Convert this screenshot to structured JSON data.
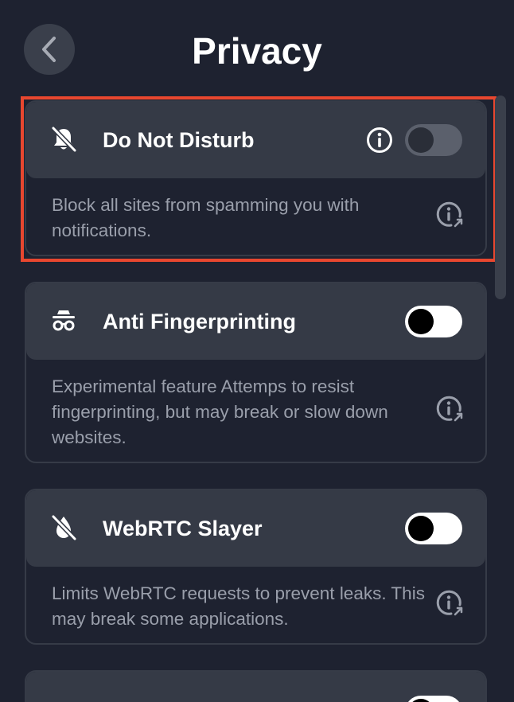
{
  "header": {
    "title": "Privacy",
    "back_icon": "chevron-left-icon"
  },
  "cards": [
    {
      "title": "Do Not Disturb",
      "icon": "bell-off-icon",
      "description": "Block all sites from spamming you with notifications.",
      "toggle_on": false,
      "has_info_icon": true,
      "highlighted": true
    },
    {
      "title": "Anti Fingerprinting",
      "icon": "incognito-spy-icon",
      "description": "Experimental feature Attemps to resist fingerprinting, but may break or slow down websites.",
      "toggle_on": false,
      "has_info_icon": false
    },
    {
      "title": "WebRTC Slayer",
      "icon": "webrtc-off-icon",
      "description": "Limits WebRTC requests to prevent leaks. This may break some applications.",
      "toggle_on": false,
      "has_info_icon": false
    }
  ],
  "colors": {
    "background": "#1e2230",
    "card_header": "#353a46",
    "highlight": "#e8472f",
    "description_text": "#9a9fab"
  }
}
